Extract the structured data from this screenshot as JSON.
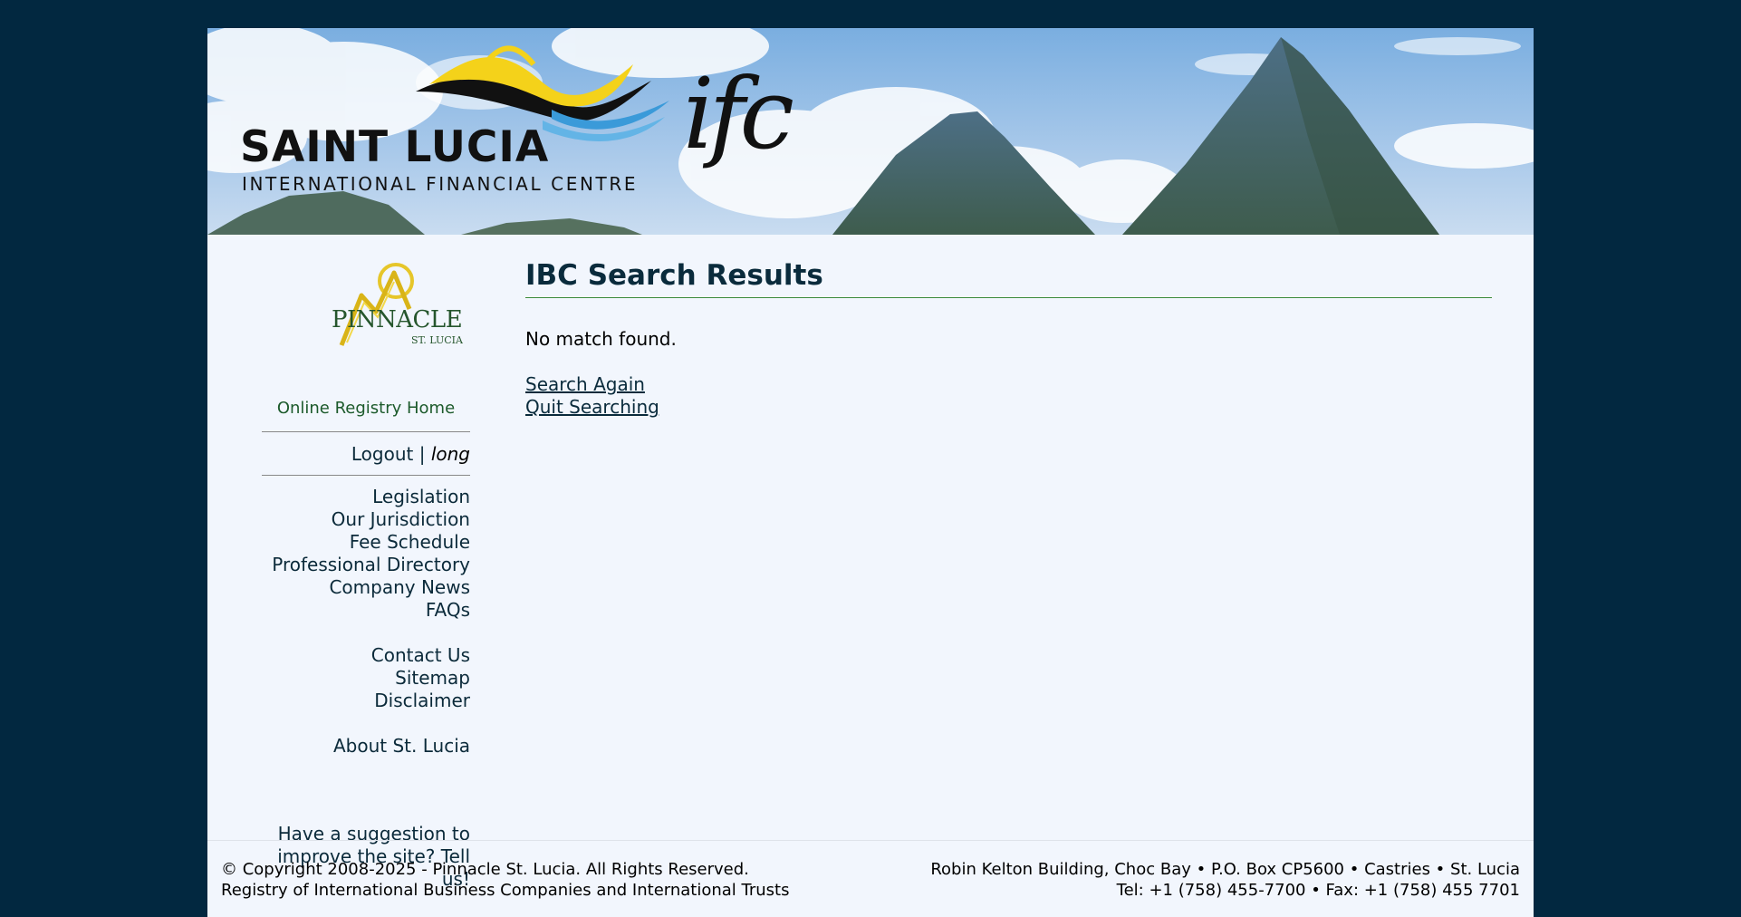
{
  "brand": {
    "title": "SAINT LUCIA",
    "subtitle": "INTERNATIONAL FINANCIAL CENTRE",
    "ifc": "ifc"
  },
  "sidebar": {
    "logo_word": "PINNACLE",
    "logo_sub": "ST. LUCIA",
    "registry_home": "Online Registry Home",
    "logout": "Logout",
    "separator": "|",
    "username": "long",
    "nav_groups": [
      [
        "Legislation",
        "Our Jurisdiction",
        "Fee Schedule",
        "Professional Directory",
        "Company News",
        "FAQs"
      ],
      [
        "Contact Us",
        "Sitemap",
        "Disclaimer"
      ],
      [
        "About St. Lucia"
      ]
    ],
    "suggestion_line1": "Have a suggestion to",
    "suggestion_line2": "improve the site? Tell us!"
  },
  "main": {
    "title": "IBC Search Results",
    "message": "No match found.",
    "search_again": "Search Again",
    "quit_searching": "Quit Searching"
  },
  "footer": {
    "copyright": "© Copyright 2008-2025 - Pinnacle St. Lucia. All Rights Reserved.",
    "registry": "Registry of International Business Companies and International Trusts",
    "address": "Robin Kelton Building, Choc Bay • P.O. Box CP5600 • Castries • St. Lucia",
    "contact": "Tel: +1 (758) 455-7700 • Fax: +1 (758) 455 7701"
  },
  "colors": {
    "outer_background": "#022840",
    "page_background": "#f2f6fd",
    "title_color": "#0a2b3c",
    "rule_green": "#3b8a3b",
    "registry_home_green": "#1c5a2b",
    "logo_yellow": "#f4d21a",
    "logo_blue": "#3a9ad9"
  }
}
